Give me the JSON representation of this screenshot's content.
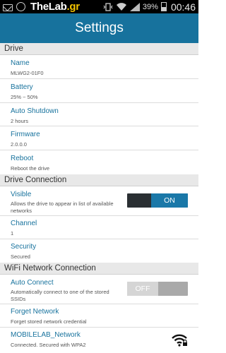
{
  "status_bar": {
    "brand_part1": "TheLab",
    "brand_part2": ".gr",
    "battery_percent": "39%",
    "time": "00:46"
  },
  "app_bar": {
    "title": "Settings"
  },
  "sections": {
    "drive": "Drive",
    "drive_connection": "Drive Connection",
    "wifi": "WiFi Network Connection"
  },
  "drive": {
    "name": {
      "label": "Name",
      "value": "MLWG2-01F0"
    },
    "battery": {
      "label": "Battery",
      "value": "25% ~ 50%"
    },
    "auto_shutdown": {
      "label": "Auto Shutdown",
      "value": "2 hours"
    },
    "firmware": {
      "label": "Firmware",
      "value": "2.0.0.0"
    },
    "reboot": {
      "label": "Reboot",
      "value": "Reboot the drive"
    }
  },
  "drive_connection": {
    "visible": {
      "label": "Visible",
      "value": "Allows the drive to appear in list of available networks",
      "toggle_label": "ON"
    },
    "channel": {
      "label": "Channel",
      "value": "1"
    },
    "security": {
      "label": "Security",
      "value": "Secured"
    }
  },
  "wifi": {
    "auto_connect": {
      "label": "Auto Connect",
      "value": "Automatically connect to one of the stored SSIDs",
      "toggle_label": "OFF"
    },
    "forget_network": {
      "label": "Forget Network",
      "value": "Forget stored network credential"
    },
    "network": {
      "label": "MOBILELAB_Network",
      "value": "Connected. Secured with WPA2"
    }
  },
  "colors": {
    "accent": "#17729d",
    "toggle_on": "#1a78a8",
    "section_bg": "#e8e8e8"
  }
}
